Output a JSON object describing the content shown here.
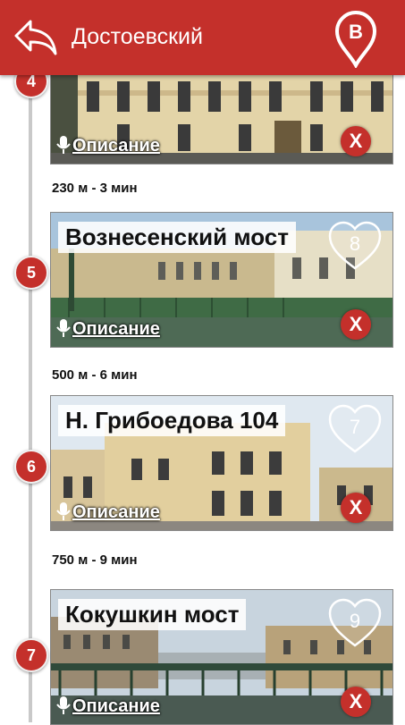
{
  "header": {
    "title": "Достоевский",
    "pin_letter": "B",
    "back_icon": "back-arrow-icon"
  },
  "colors": {
    "primary": "#c4302b",
    "timeline": "#c9c9c9"
  },
  "stops": [
    {
      "number": "4",
      "description": "Описание",
      "remove": "X"
    },
    {
      "number": "5",
      "name": "Вознесенский мост",
      "favorites": "8",
      "description": "Описание",
      "remove": "X"
    },
    {
      "number": "6",
      "name": "Н. Грибоедова 104",
      "favorites": "7",
      "description": "Описание",
      "remove": "X"
    },
    {
      "number": "7",
      "name": "Кокушкин мост",
      "favorites": "9",
      "description": "Описание",
      "remove": "X"
    }
  ],
  "distances": [
    "230 м - 3 мин",
    "500 м - 6 мин",
    "750 м - 9 мин"
  ]
}
